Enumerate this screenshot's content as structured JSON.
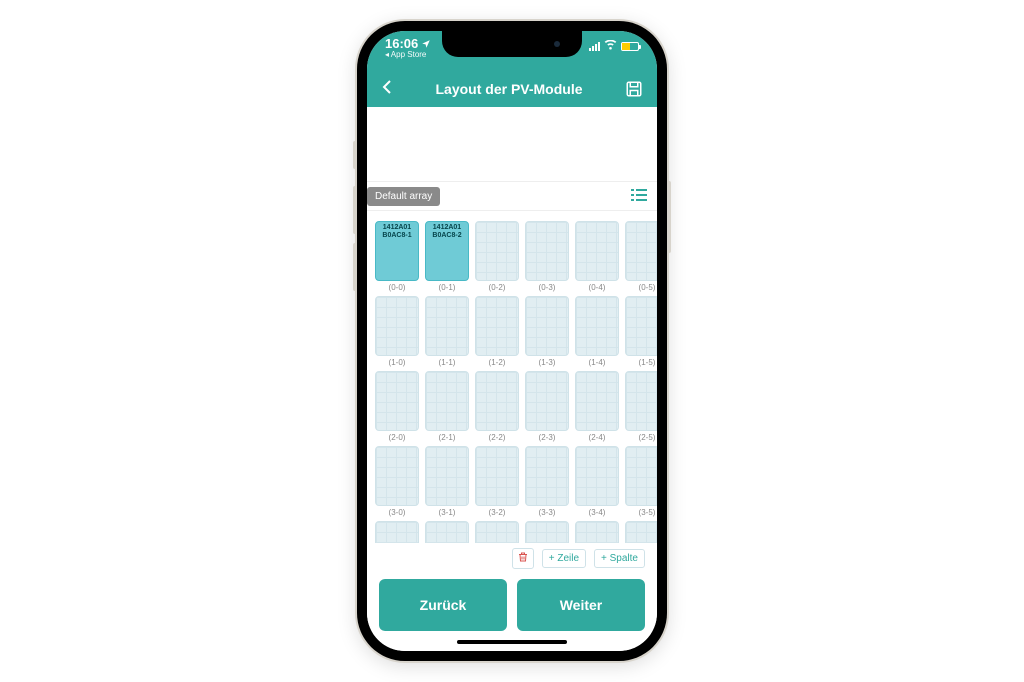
{
  "status": {
    "time": "16:06",
    "app_return": "App Store"
  },
  "nav": {
    "title": "Layout der PV-Module"
  },
  "array": {
    "chip": "Default array"
  },
  "modules": {
    "assigned": [
      {
        "row": 0,
        "col": 0,
        "line1": "1412A01",
        "line2": "B0AC8-1"
      },
      {
        "row": 0,
        "col": 1,
        "line1": "1412A01",
        "line2": "B0AC8-2"
      }
    ],
    "rows": 5,
    "cols": 6
  },
  "toolbar": {
    "add_row": "+ Zeile",
    "add_col": "+ Spalte"
  },
  "footer": {
    "back": "Zurück",
    "next": "Weiter"
  }
}
